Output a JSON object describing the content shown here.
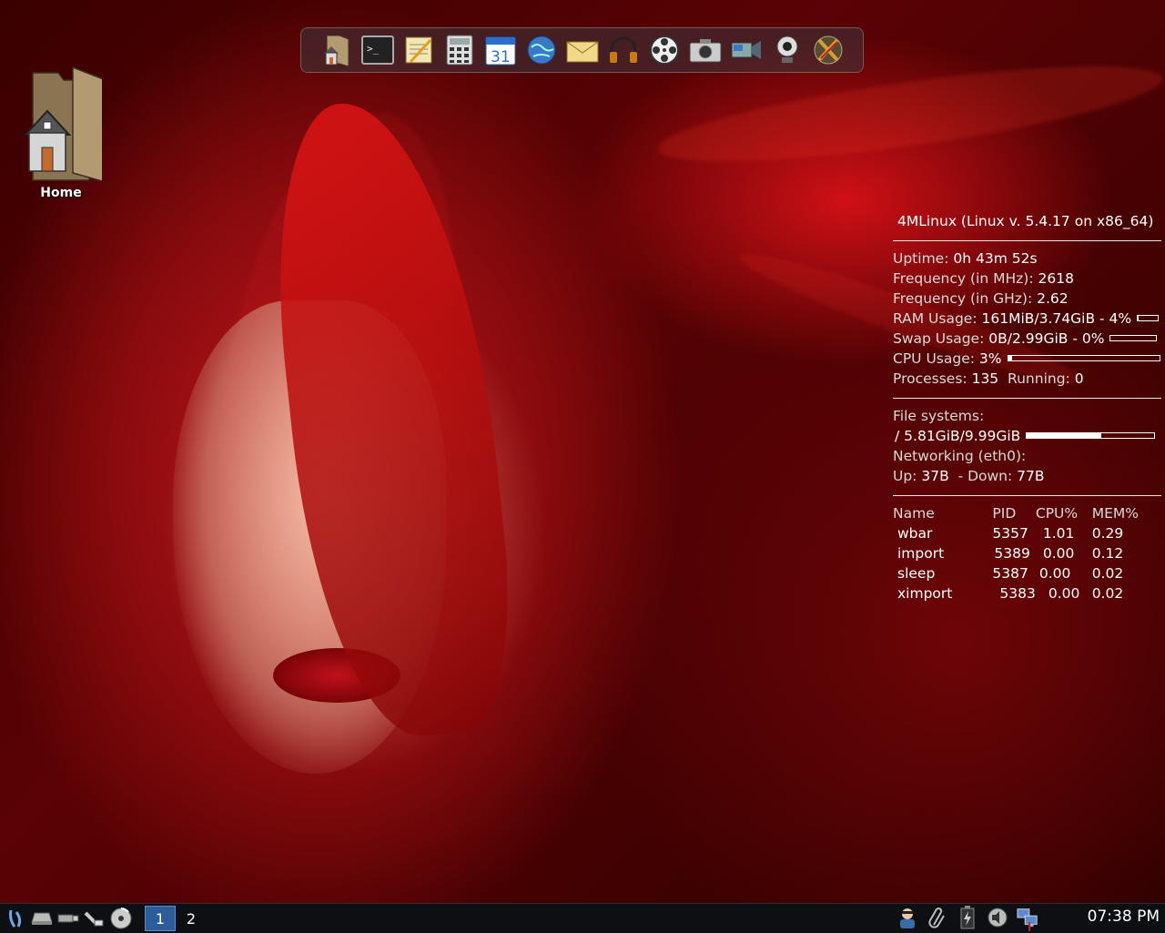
{
  "desktop": {
    "icons": [
      {
        "label": "Home",
        "icon": "home-folder-icon"
      }
    ]
  },
  "dock": {
    "items": [
      {
        "name": "home-folder-icon"
      },
      {
        "name": "terminal-icon"
      },
      {
        "name": "text-editor-icon"
      },
      {
        "name": "calculator-icon"
      },
      {
        "name": "calendar-icon",
        "text": "31"
      },
      {
        "name": "web-browser-icon"
      },
      {
        "name": "mail-icon"
      },
      {
        "name": "headphones-icon"
      },
      {
        "name": "film-reel-icon"
      },
      {
        "name": "camera-icon"
      },
      {
        "name": "video-camera-icon"
      },
      {
        "name": "webcam-icon"
      },
      {
        "name": "x-tools-icon"
      }
    ]
  },
  "conky": {
    "header": "4MLinux (Linux v. 5.4.17 on x86_64)",
    "uptime_label": "Uptime:",
    "uptime_value": "0h 43m 52s",
    "freq_mhz_label": "Frequency (in MHz):",
    "freq_mhz_value": "2618",
    "freq_ghz_label": "Frequency (in GHz):",
    "freq_ghz_value": "2.62",
    "ram_label": "RAM Usage:",
    "ram_value": "161MiB/3.74GiB - 4%",
    "ram_fraction": 0.04,
    "swap_label": "Swap Usage:",
    "swap_value": "0B/2.99GiB - 0%",
    "swap_fraction": 0.0,
    "cpu_label": "CPU Usage:",
    "cpu_value": "3%",
    "cpu_fraction": 0.03,
    "processes_label": "Processes:",
    "processes_value": "135",
    "running_label": "Running:",
    "running_value": "0",
    "fs_label": "File systems:",
    "fs_root_label": " /",
    "fs_root_value": "5.81GiB/9.99GiB",
    "fs_root_fraction": 0.58,
    "net_label": "Networking (eth0):",
    "up_label": "Up:",
    "up_value": "37B",
    "down_label": "- Down:",
    "down_value": "77B",
    "proc_headers": [
      "Name",
      "PID",
      "CPU%",
      "MEM%"
    ],
    "procs": [
      [
        "wbar",
        "5357",
        "1.01",
        "0.29"
      ],
      [
        "import",
        "5389",
        "0.00",
        "0.12"
      ],
      [
        "sleep",
        "5387",
        "0.00",
        "0.02"
      ],
      [
        "ximport",
        "5383",
        "0.00",
        "0.02"
      ]
    ]
  },
  "taskbar": {
    "launchers": [
      "menu-icon",
      "drive-icon",
      "usb-icon",
      "network-cable-icon",
      "cd-icon"
    ],
    "workspaces": [
      {
        "label": "1",
        "active": true
      },
      {
        "label": "2",
        "active": false
      }
    ],
    "tray": [
      "user-icon",
      "paperclip-icon",
      "battery-charging-icon",
      "speaker-icon",
      "network-computers-icon"
    ],
    "clock": "07:38 PM"
  }
}
